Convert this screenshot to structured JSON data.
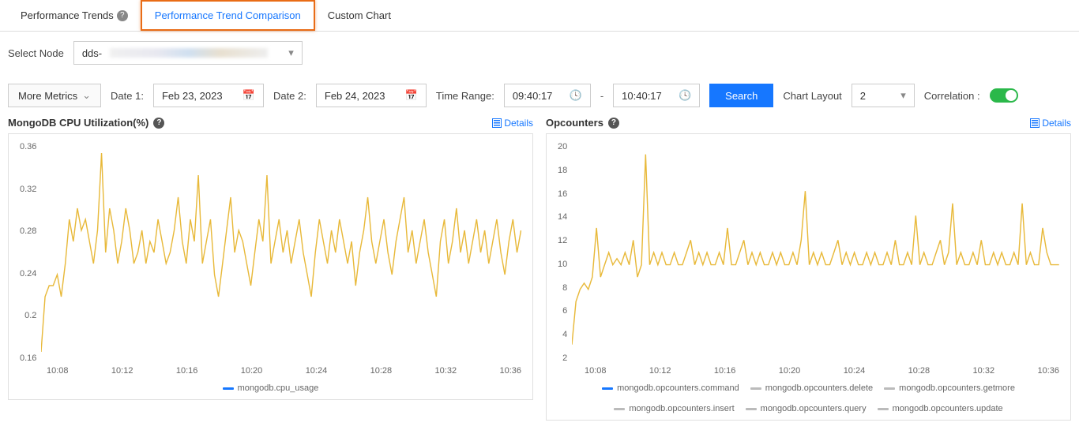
{
  "tabs": {
    "performance_trends": "Performance Trends",
    "performance_trend_comparison": "Performance Trend Comparison",
    "custom_chart": "Custom Chart"
  },
  "node_row": {
    "label": "Select Node",
    "prefix": "dds-"
  },
  "controls": {
    "more_metrics": "More Metrics",
    "date1_label": "Date 1:",
    "date1_value": "Feb 23, 2023",
    "date2_label": "Date 2:",
    "date2_value": "Feb 24, 2023",
    "time_range_label": "Time Range:",
    "time_from": "09:40:17",
    "time_to": "10:40:17",
    "search": "Search",
    "chart_layout_label": "Chart Layout",
    "chart_layout_value": "2",
    "correlation_label": "Correlation :"
  },
  "charts": {
    "cpu": {
      "title": "MongoDB CPU Utilization(%)",
      "details": "Details",
      "legend": [
        "mongodb.cpu_usage"
      ]
    },
    "op": {
      "title": "Opcounters",
      "details": "Details",
      "legend": [
        "mongodb.opcounters.command",
        "mongodb.opcounters.delete",
        "mongodb.opcounters.getmore",
        "mongodb.opcounters.insert",
        "mongodb.opcounters.query",
        "mongodb.opcounters.update"
      ]
    }
  },
  "chart_data": [
    {
      "type": "line",
      "title": "MongoDB CPU Utilization(%)",
      "ylabel": "",
      "xlabel": "",
      "ylim": [
        0.16,
        0.36
      ],
      "y_ticks": [
        0.36,
        0.32,
        0.28,
        0.24,
        0.2,
        0.16
      ],
      "x_ticks": [
        "10:08",
        "10:12",
        "10:16",
        "10:20",
        "10:24",
        "10:28",
        "10:32",
        "10:36"
      ],
      "series": [
        {
          "name": "mongodb.cpu_usage",
          "values": [
            0.17,
            0.22,
            0.23,
            0.23,
            0.24,
            0.22,
            0.25,
            0.29,
            0.27,
            0.3,
            0.28,
            0.29,
            0.27,
            0.25,
            0.28,
            0.35,
            0.26,
            0.3,
            0.28,
            0.25,
            0.27,
            0.3,
            0.28,
            0.25,
            0.26,
            0.28,
            0.25,
            0.27,
            0.26,
            0.29,
            0.27,
            0.25,
            0.26,
            0.28,
            0.31,
            0.27,
            0.25,
            0.29,
            0.27,
            0.33,
            0.25,
            0.27,
            0.29,
            0.24,
            0.22,
            0.25,
            0.28,
            0.31,
            0.26,
            0.28,
            0.27,
            0.25,
            0.23,
            0.26,
            0.29,
            0.27,
            0.33,
            0.25,
            0.27,
            0.29,
            0.26,
            0.28,
            0.25,
            0.27,
            0.29,
            0.26,
            0.24,
            0.22,
            0.26,
            0.29,
            0.27,
            0.25,
            0.28,
            0.26,
            0.29,
            0.27,
            0.25,
            0.27,
            0.23,
            0.26,
            0.28,
            0.31,
            0.27,
            0.25,
            0.27,
            0.29,
            0.26,
            0.24,
            0.27,
            0.29,
            0.31,
            0.26,
            0.28,
            0.25,
            0.27,
            0.29,
            0.26,
            0.24,
            0.22,
            0.27,
            0.29,
            0.25,
            0.27,
            0.3,
            0.26,
            0.28,
            0.25,
            0.27,
            0.29,
            0.26,
            0.28,
            0.25,
            0.27,
            0.29,
            0.26,
            0.24,
            0.27,
            0.29,
            0.26,
            0.28
          ]
        }
      ]
    },
    {
      "type": "line",
      "title": "Opcounters",
      "ylabel": "",
      "xlabel": "",
      "ylim": [
        2,
        20
      ],
      "y_ticks": [
        20,
        18,
        16,
        14,
        12,
        10,
        8,
        6,
        4,
        2
      ],
      "x_ticks": [
        "10:08",
        "10:12",
        "10:16",
        "10:20",
        "10:24",
        "10:28",
        "10:32",
        "10:36"
      ],
      "series": [
        {
          "name": "mongodb.opcounters.command",
          "values": [
            3.5,
            7,
            8,
            8.5,
            8,
            9,
            13,
            9,
            10,
            11,
            10,
            10.5,
            10,
            11,
            10,
            12,
            9,
            10,
            19,
            10,
            11,
            10,
            11,
            10,
            10,
            11,
            10,
            10,
            11,
            12,
            10,
            11,
            10,
            11,
            10,
            10,
            11,
            10,
            13,
            10,
            10,
            11,
            12,
            10,
            11,
            10,
            11,
            10,
            10,
            11,
            10,
            11,
            10,
            10,
            11,
            10,
            12,
            16,
            10,
            11,
            10,
            11,
            10,
            10,
            11,
            12,
            10,
            11,
            10,
            11,
            10,
            10,
            11,
            10,
            11,
            10,
            10,
            11,
            10,
            12,
            10,
            10,
            11,
            10,
            14,
            10,
            11,
            10,
            10,
            11,
            12,
            10,
            11,
            15,
            10,
            11,
            10,
            10,
            11,
            10,
            12,
            10,
            10,
            11,
            10,
            11,
            10,
            10,
            11,
            10,
            15,
            10,
            11,
            10,
            10,
            13,
            11,
            10,
            10,
            10
          ]
        },
        {
          "name": "mongodb.opcounters.delete",
          "values": []
        },
        {
          "name": "mongodb.opcounters.getmore",
          "values": []
        },
        {
          "name": "mongodb.opcounters.insert",
          "values": []
        },
        {
          "name": "mongodb.opcounters.query",
          "values": []
        },
        {
          "name": "mongodb.opcounters.update",
          "values": []
        }
      ]
    }
  ]
}
